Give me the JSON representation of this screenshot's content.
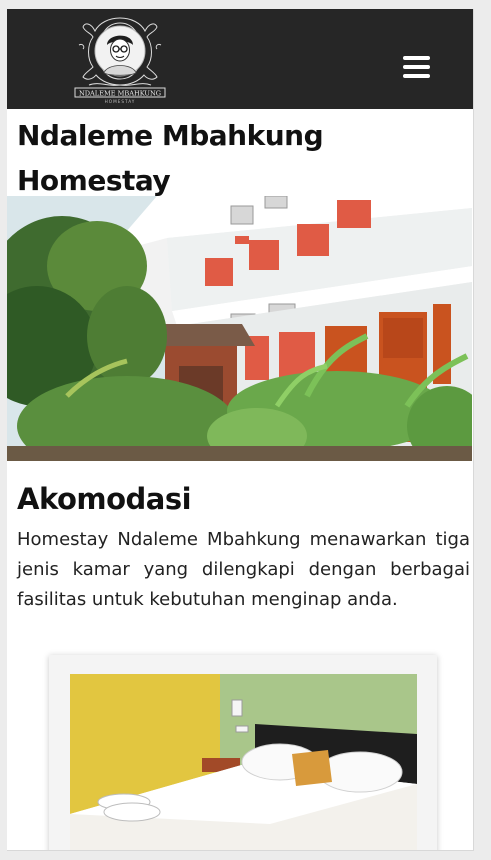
{
  "brand": {
    "name": "NDALEME MBAHKUNG",
    "tagline": "HOMESTAY"
  },
  "nav": {
    "menu_icon": "hamburger-menu-icon"
  },
  "page": {
    "title": "Ndaleme Mbahkung Homestay"
  },
  "accommodation": {
    "heading": "Akomodasi",
    "description": "Homestay Ndaleme Mbahkung menawarkan tiga jenis kamar yang dilengkapi dengan berbagai fasilitas untuk kebutuhan menginap anda."
  },
  "colors": {
    "navbar": "#262626",
    "background": "#ececec",
    "card": "#f4f4f4",
    "brick": "#e05b45",
    "door": "#c9531f"
  }
}
